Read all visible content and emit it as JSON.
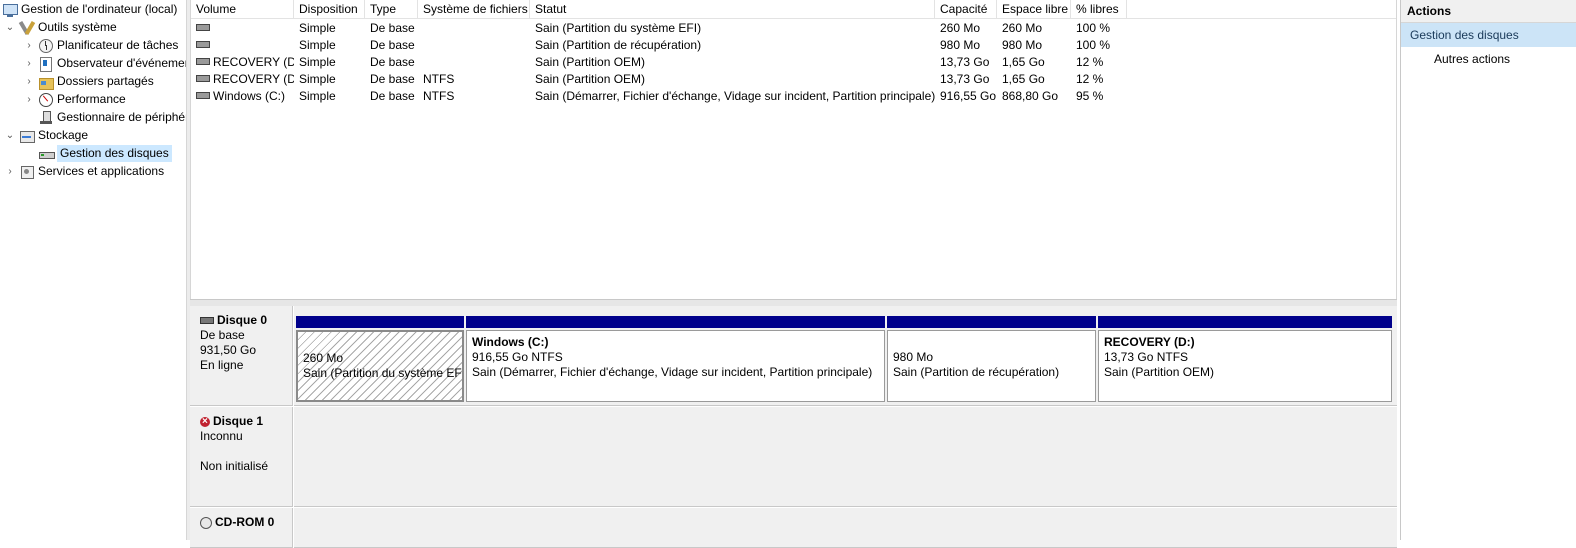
{
  "tree": [
    {
      "label": "Gestion de l'ordinateur (local)",
      "icon": "computer-icon",
      "twisty": ""
    },
    {
      "label": "Outils système",
      "icon": "tools-icon",
      "twisty": "v"
    },
    {
      "label": "Planificateur de tâches",
      "icon": "clock-icon",
      "twisty": ">"
    },
    {
      "label": "Observateur d'événements",
      "icon": "event-log-icon",
      "twisty": ">"
    },
    {
      "label": "Dossiers partagés",
      "icon": "shared-folder-icon",
      "twisty": ">"
    },
    {
      "label": "Performance",
      "icon": "performance-icon",
      "twisty": ">"
    },
    {
      "label": "Gestionnaire de périphériques",
      "icon": "device-manager-icon",
      "twisty": ""
    },
    {
      "label": "Stockage",
      "icon": "storage-icon",
      "twisty": "v"
    },
    {
      "label": "Gestion des disques",
      "icon": "disk-icon",
      "twisty": ""
    },
    {
      "label": "Services et applications",
      "icon": "services-icon",
      "twisty": ">"
    }
  ],
  "volumes": {
    "columns": [
      "Volume",
      "Disposition",
      "Type",
      "Système de fichiers",
      "Statut",
      "Capacité",
      "Espace libre",
      "% libres"
    ],
    "rows": [
      {
        "volume": "",
        "layout": "Simple",
        "type": "De base",
        "fs": "",
        "status": "Sain (Partition du système EFI)",
        "capacity": "260 Mo",
        "free": "260 Mo",
        "pct": "100 %"
      },
      {
        "volume": "",
        "layout": "Simple",
        "type": "De base",
        "fs": "",
        "status": "Sain (Partition de récupération)",
        "capacity": "980 Mo",
        "free": "980 Mo",
        "pct": "100 %"
      },
      {
        "volume": "RECOVERY (D:)",
        "layout": "Simple",
        "type": "De base",
        "fs": "",
        "status": "Sain (Partition OEM)",
        "capacity": "13,73 Go",
        "free": "1,65 Go",
        "pct": "12 %"
      },
      {
        "volume": "RECOVERY (D:)",
        "layout": "Simple",
        "type": "De base",
        "fs": "NTFS",
        "status": "Sain (Partition OEM)",
        "capacity": "13,73 Go",
        "free": "1,65 Go",
        "pct": "12 %"
      },
      {
        "volume": "Windows (C:)",
        "layout": "Simple",
        "type": "De base",
        "fs": "NTFS",
        "status": "Sain (Démarrer, Fichier d'échange, Vidage sur incident, Partition principale)",
        "capacity": "916,55 Go",
        "free": "868,80 Go",
        "pct": "95 %"
      }
    ]
  },
  "disks": {
    "disk0": {
      "name": "Disque 0",
      "type": "De base",
      "size": "931,50 Go",
      "state": "En ligne",
      "partitions": [
        {
          "name": "",
          "size": "260 Mo",
          "status": "Sain (Partition du système EFI)"
        },
        {
          "name": "Windows  (C:)",
          "size": "916,55 Go NTFS",
          "status": "Sain (Démarrer, Fichier d'échange, Vidage sur incident, Partition principale)"
        },
        {
          "name": "",
          "size": "980 Mo",
          "status": "Sain (Partition de récupération)"
        },
        {
          "name": "RECOVERY  (D:)",
          "size": "13,73 Go NTFS",
          "status": "Sain (Partition OEM)"
        }
      ]
    },
    "disk1": {
      "name": "Disque 1",
      "type": "Inconnu",
      "state": "Non initialisé"
    },
    "cdrom0": {
      "name": "CD-ROM 0"
    }
  },
  "actions": {
    "title": "Actions",
    "section": "Gestion des disques",
    "item": "Autres actions"
  },
  "colors": {
    "partition_bar": "#00008b",
    "selection": "#cce8ff",
    "actions_section": "#cce4f7"
  }
}
